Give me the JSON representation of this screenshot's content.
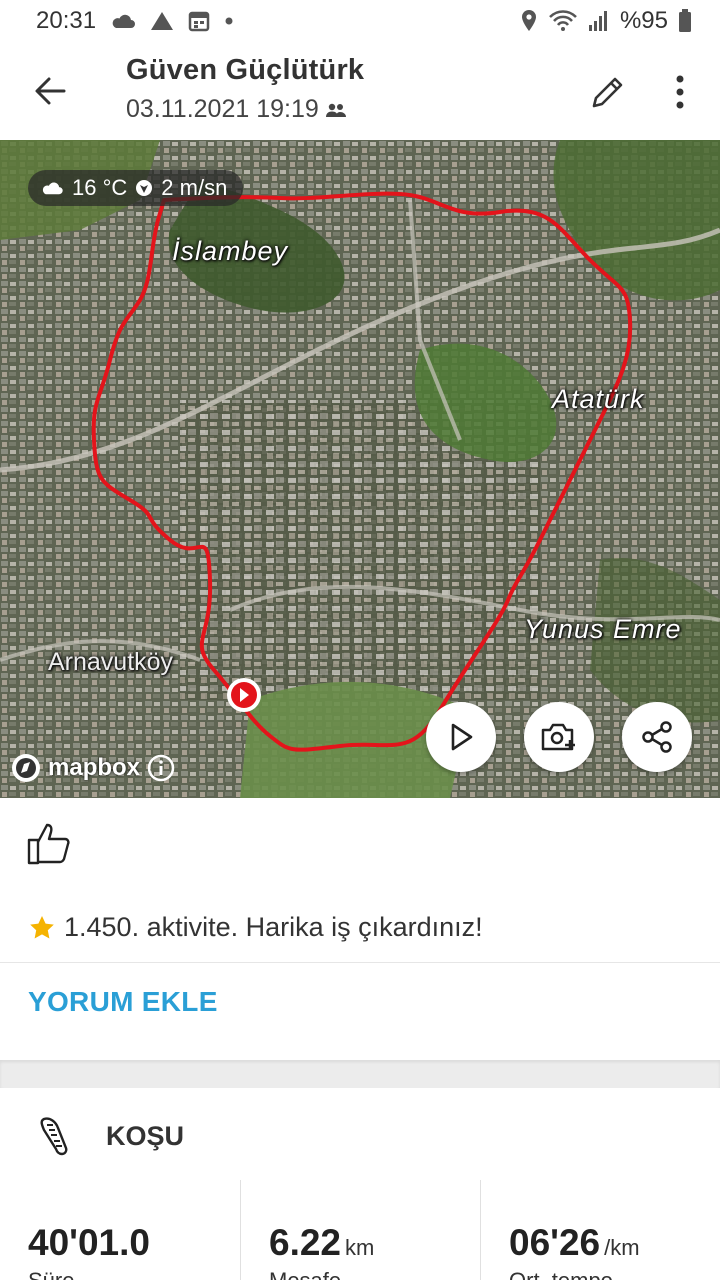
{
  "status_bar": {
    "time": "20:31",
    "battery": "%95",
    "icons": [
      "cloud-icon",
      "warning-triangle-icon",
      "calendar-icon",
      "dot-icon",
      "location-icon",
      "wifi-icon",
      "signal-icon",
      "battery-icon"
    ]
  },
  "header": {
    "title": "Güven Güçlütürk",
    "datetime": "03.11.2021 19:19"
  },
  "map": {
    "weather": {
      "temperature": "16 °C",
      "wind": "2 m/sn"
    },
    "labels": {
      "islambey": "İslambey",
      "ataturk": "Atatürk",
      "yunus_emre": "Yunus Emre",
      "arnavutkoy": "Arnavutköy"
    },
    "attribution": "mapbox",
    "route_color": "#e3141b"
  },
  "social": {
    "achievement": "1.450. aktivite. Harika iş çıkardınız!",
    "comment_button": "YORUM EKLE"
  },
  "activity": {
    "sport": "KOŞU",
    "stats": [
      {
        "value": "40'01.0",
        "unit": "",
        "label": "Süre"
      },
      {
        "value": "6.22",
        "unit": "km",
        "label": "Mesafe"
      },
      {
        "value": "06'26",
        "unit": "/km",
        "label": "Ort. tempo"
      }
    ]
  },
  "colors": {
    "accent": "#2a9fd6",
    "star": "#f5b301"
  }
}
